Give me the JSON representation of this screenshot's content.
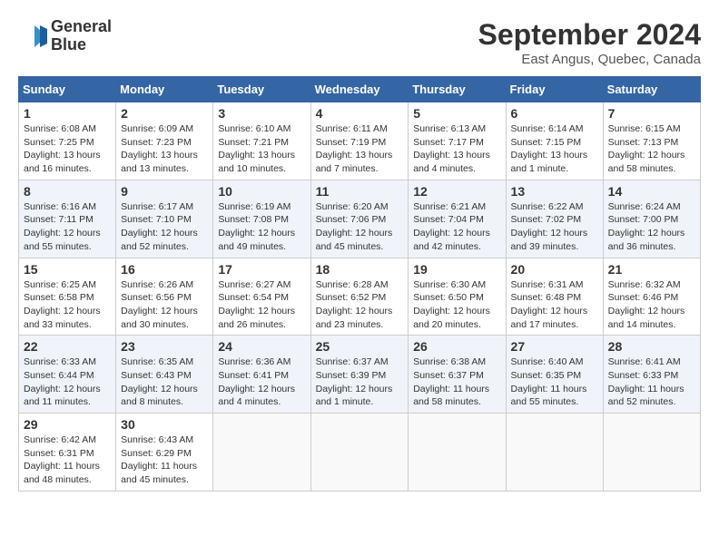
{
  "header": {
    "logo_line1": "General",
    "logo_line2": "Blue",
    "month_title": "September 2024",
    "location": "East Angus, Quebec, Canada"
  },
  "weekdays": [
    "Sunday",
    "Monday",
    "Tuesday",
    "Wednesday",
    "Thursday",
    "Friday",
    "Saturday"
  ],
  "weeks": [
    [
      {
        "day": "1",
        "sunrise": "6:08 AM",
        "sunset": "7:25 PM",
        "daylight": "13 hours and 16 minutes."
      },
      {
        "day": "2",
        "sunrise": "6:09 AM",
        "sunset": "7:23 PM",
        "daylight": "13 hours and 13 minutes."
      },
      {
        "day": "3",
        "sunrise": "6:10 AM",
        "sunset": "7:21 PM",
        "daylight": "13 hours and 10 minutes."
      },
      {
        "day": "4",
        "sunrise": "6:11 AM",
        "sunset": "7:19 PM",
        "daylight": "13 hours and 7 minutes."
      },
      {
        "day": "5",
        "sunrise": "6:13 AM",
        "sunset": "7:17 PM",
        "daylight": "13 hours and 4 minutes."
      },
      {
        "day": "6",
        "sunrise": "6:14 AM",
        "sunset": "7:15 PM",
        "daylight": "13 hours and 1 minute."
      },
      {
        "day": "7",
        "sunrise": "6:15 AM",
        "sunset": "7:13 PM",
        "daylight": "12 hours and 58 minutes."
      }
    ],
    [
      {
        "day": "8",
        "sunrise": "6:16 AM",
        "sunset": "7:11 PM",
        "daylight": "12 hours and 55 minutes."
      },
      {
        "day": "9",
        "sunrise": "6:17 AM",
        "sunset": "7:10 PM",
        "daylight": "12 hours and 52 minutes."
      },
      {
        "day": "10",
        "sunrise": "6:19 AM",
        "sunset": "7:08 PM",
        "daylight": "12 hours and 49 minutes."
      },
      {
        "day": "11",
        "sunrise": "6:20 AM",
        "sunset": "7:06 PM",
        "daylight": "12 hours and 45 minutes."
      },
      {
        "day": "12",
        "sunrise": "6:21 AM",
        "sunset": "7:04 PM",
        "daylight": "12 hours and 42 minutes."
      },
      {
        "day": "13",
        "sunrise": "6:22 AM",
        "sunset": "7:02 PM",
        "daylight": "12 hours and 39 minutes."
      },
      {
        "day": "14",
        "sunrise": "6:24 AM",
        "sunset": "7:00 PM",
        "daylight": "12 hours and 36 minutes."
      }
    ],
    [
      {
        "day": "15",
        "sunrise": "6:25 AM",
        "sunset": "6:58 PM",
        "daylight": "12 hours and 33 minutes."
      },
      {
        "day": "16",
        "sunrise": "6:26 AM",
        "sunset": "6:56 PM",
        "daylight": "12 hours and 30 minutes."
      },
      {
        "day": "17",
        "sunrise": "6:27 AM",
        "sunset": "6:54 PM",
        "daylight": "12 hours and 26 minutes."
      },
      {
        "day": "18",
        "sunrise": "6:28 AM",
        "sunset": "6:52 PM",
        "daylight": "12 hours and 23 minutes."
      },
      {
        "day": "19",
        "sunrise": "6:30 AM",
        "sunset": "6:50 PM",
        "daylight": "12 hours and 20 minutes."
      },
      {
        "day": "20",
        "sunrise": "6:31 AM",
        "sunset": "6:48 PM",
        "daylight": "12 hours and 17 minutes."
      },
      {
        "day": "21",
        "sunrise": "6:32 AM",
        "sunset": "6:46 PM",
        "daylight": "12 hours and 14 minutes."
      }
    ],
    [
      {
        "day": "22",
        "sunrise": "6:33 AM",
        "sunset": "6:44 PM",
        "daylight": "12 hours and 11 minutes."
      },
      {
        "day": "23",
        "sunrise": "6:35 AM",
        "sunset": "6:43 PM",
        "daylight": "12 hours and 8 minutes."
      },
      {
        "day": "24",
        "sunrise": "6:36 AM",
        "sunset": "6:41 PM",
        "daylight": "12 hours and 4 minutes."
      },
      {
        "day": "25",
        "sunrise": "6:37 AM",
        "sunset": "6:39 PM",
        "daylight": "12 hours and 1 minute."
      },
      {
        "day": "26",
        "sunrise": "6:38 AM",
        "sunset": "6:37 PM",
        "daylight": "11 hours and 58 minutes."
      },
      {
        "day": "27",
        "sunrise": "6:40 AM",
        "sunset": "6:35 PM",
        "daylight": "11 hours and 55 minutes."
      },
      {
        "day": "28",
        "sunrise": "6:41 AM",
        "sunset": "6:33 PM",
        "daylight": "11 hours and 52 minutes."
      }
    ],
    [
      {
        "day": "29",
        "sunrise": "6:42 AM",
        "sunset": "6:31 PM",
        "daylight": "11 hours and 48 minutes."
      },
      {
        "day": "30",
        "sunrise": "6:43 AM",
        "sunset": "6:29 PM",
        "daylight": "11 hours and 45 minutes."
      },
      null,
      null,
      null,
      null,
      null
    ]
  ]
}
